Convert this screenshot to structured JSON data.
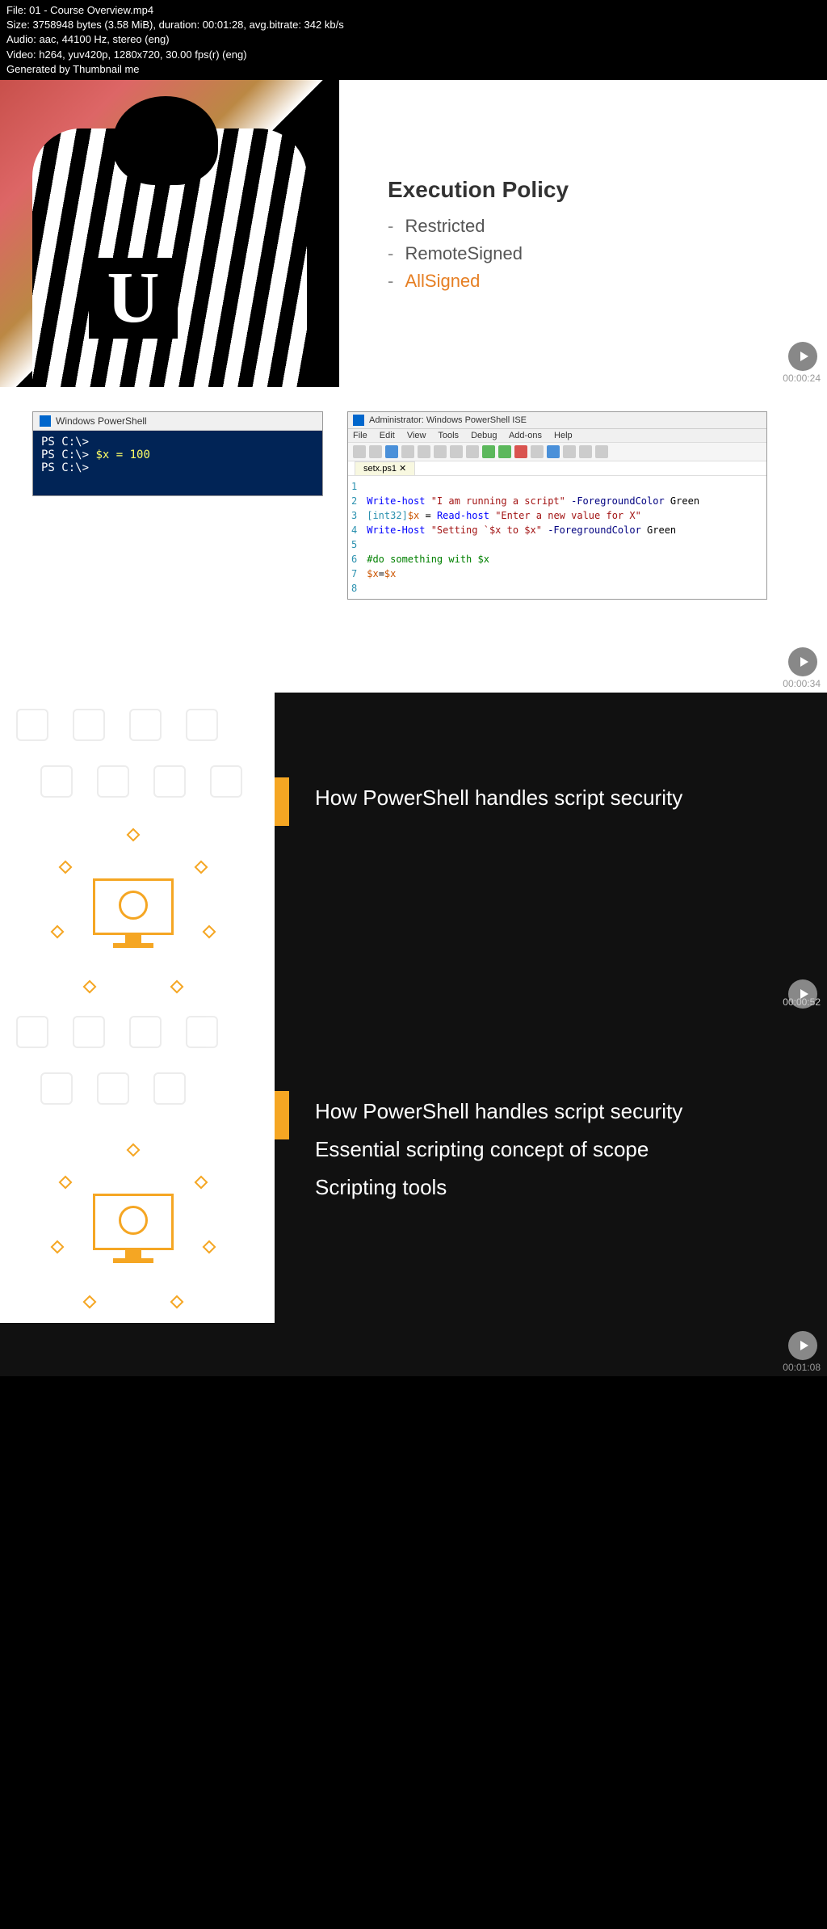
{
  "meta": {
    "line1": "File: 01 - Course Overview.mp4",
    "line2": "Size: 3758948 bytes (3.58 MiB), duration: 00:01:28, avg.bitrate: 342 kb/s",
    "line3": "Audio: aac, 44100 Hz, stereo (eng)",
    "line4": "Video: h264, yuv420p, 1280x720, 30.00 fps(r) (eng)",
    "line5": "Generated by Thumbnail me"
  },
  "slide1": {
    "badge": "U",
    "title": "Execution Policy",
    "items": [
      "Restricted",
      "RemoteSigned",
      "AllSigned"
    ],
    "timestamp": "00:00:24"
  },
  "slide2": {
    "ps_title": "Windows PowerShell",
    "ps_line1": "PS C:\\>",
    "ps_line2a": "PS C:\\> ",
    "ps_line2b": "$x = 100",
    "ps_line3": "PS C:\\>",
    "ise_title": "Administrator: Windows PowerShell ISE",
    "menu": [
      "File",
      "Edit",
      "View",
      "Tools",
      "Debug",
      "Add-ons",
      "Help"
    ],
    "tab": "setx.ps1 ✕",
    "code_lines": [
      "1",
      "2",
      "3",
      "4",
      "5",
      "6",
      "7",
      "8"
    ],
    "code": {
      "l2_cmd": "Write-host",
      "l2_str": " \"I am running a script\"",
      "l2_param": " -ForegroundColor",
      "l2_val": " Green",
      "l3_type": "[int32]",
      "l3_var": "$x",
      "l3_eq": " = ",
      "l3_cmd": "Read-host",
      "l3_str": " \"Enter a new value for X\"",
      "l4_cmd": "Write-Host",
      "l4_str": " \"Setting `$x to $x\"",
      "l4_param": " -ForegroundColor",
      "l4_val": " Green",
      "l6_comment": "#do something with $x",
      "l7_var1": "$x",
      "l7_eq": "=",
      "l7_var2": "$x"
    },
    "timestamp": "00:00:34"
  },
  "slide3": {
    "text1": "How PowerShell handles script security",
    "timestamp": "00:00:52"
  },
  "slide4": {
    "text1": "How PowerShell handles script security",
    "text2": "Essential scripting concept of scope",
    "text3": "Scripting tools",
    "timestamp": "00:01:08"
  }
}
